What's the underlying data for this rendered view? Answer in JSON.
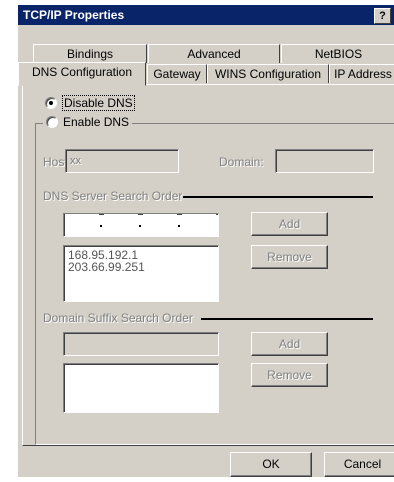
{
  "window": {
    "title": "TCP/IP Properties",
    "help_label": "?"
  },
  "tabs_back": [
    "Bindings",
    "Advanced",
    "NetBIOS"
  ],
  "tabs_front": [
    "DNS Configuration",
    "Gateway",
    "WINS Configuration",
    "IP Address"
  ],
  "dns": {
    "disable_label": "Disable DNS",
    "enable_label": "Enable DNS",
    "host_label": "Host:",
    "host_value": "xx",
    "domain_label": "Domain:",
    "server_group_label": "DNS Server Search Order",
    "add_label": "Add",
    "remove_label": "Remove",
    "servers": [
      "168.95.192.1",
      "203.66.99.251"
    ],
    "suffix_group_label": "Domain Suffix Search Order",
    "suffix_add_label": "Add",
    "suffix_remove_label": "Remove"
  },
  "footer": {
    "ok_label": "OK",
    "cancel_label": "Cancel"
  }
}
